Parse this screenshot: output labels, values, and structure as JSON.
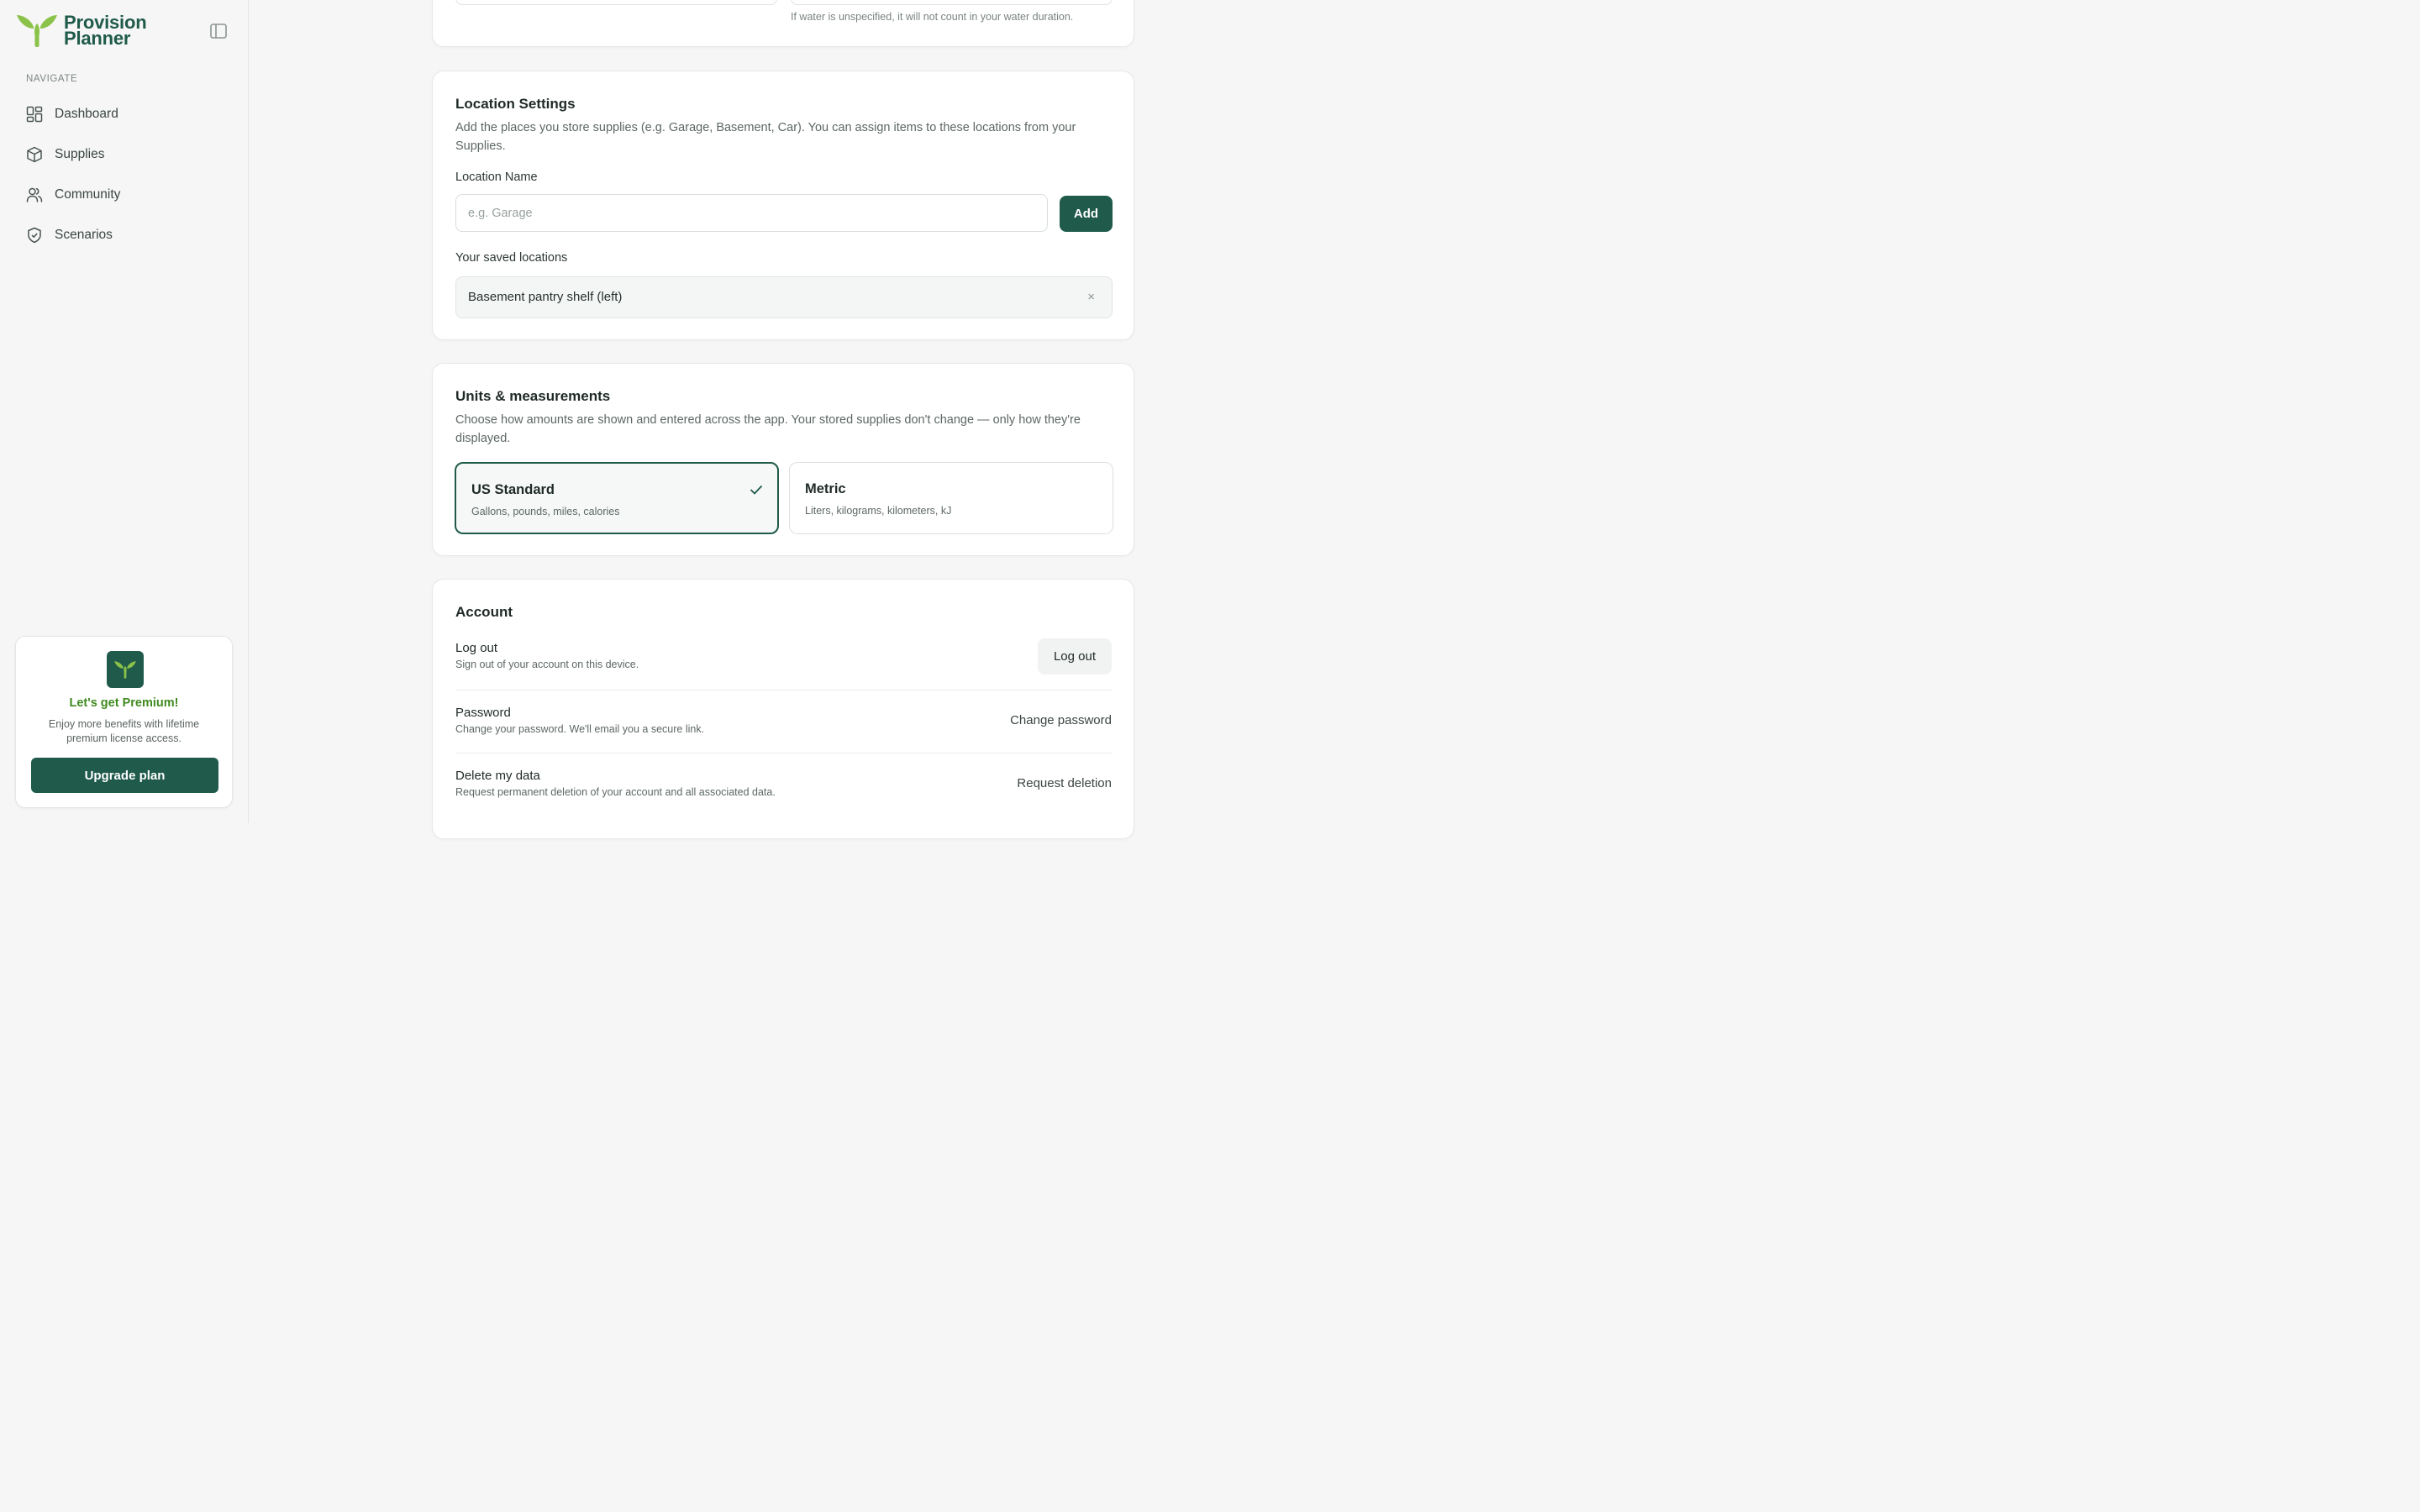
{
  "brand": {
    "line1": "Provision",
    "line2": "Planner",
    "color": "#1f5a4a",
    "accent": "#8bc34a"
  },
  "sidebar": {
    "heading": "NAVIGATE",
    "items": [
      {
        "label": "Dashboard",
        "icon": "grid-icon"
      },
      {
        "label": "Supplies",
        "icon": "box-icon"
      },
      {
        "label": "Community",
        "icon": "users-icon"
      },
      {
        "label": "Scenarios",
        "icon": "shield-check-icon"
      }
    ]
  },
  "premium": {
    "title": "Let's get Premium!",
    "description": "Enjoy more benefits with lifetime premium license access.",
    "button": "Upgrade plan"
  },
  "water": {
    "note": "If water is unspecified, it will not count in your water duration."
  },
  "location": {
    "title": "Location Settings",
    "description": "Add the places you store supplies (e.g. Garage, Basement, Car). You can assign items to these locations from your Supplies.",
    "field_label": "Location Name",
    "placeholder": "e.g. Garage",
    "value": "",
    "add_label": "Add",
    "saved_label": "Your saved locations",
    "saved": [
      {
        "name": "Basement pantry shelf (left)",
        "remove": "×"
      }
    ]
  },
  "units": {
    "title": "Units & measurements",
    "description": "Choose how amounts are shown and entered across the app. Your stored supplies don't change — only how they're displayed.",
    "options": [
      {
        "name": "US Standard",
        "desc": "Gallons, pounds, miles, calories",
        "selected": true
      },
      {
        "name": "Metric",
        "desc": "Liters, kilograms, kilometers, kJ",
        "selected": false
      }
    ]
  },
  "account": {
    "title": "Account",
    "rows": [
      {
        "title": "Log out",
        "desc": "Sign out of your account on this device.",
        "action": "Log out"
      },
      {
        "title": "Password",
        "desc": "Change your password. We'll email you a secure link.",
        "action": "Change password"
      },
      {
        "title": "Delete my data",
        "desc": "Request permanent deletion of your account and all associated data.",
        "action": "Request deletion"
      }
    ]
  }
}
